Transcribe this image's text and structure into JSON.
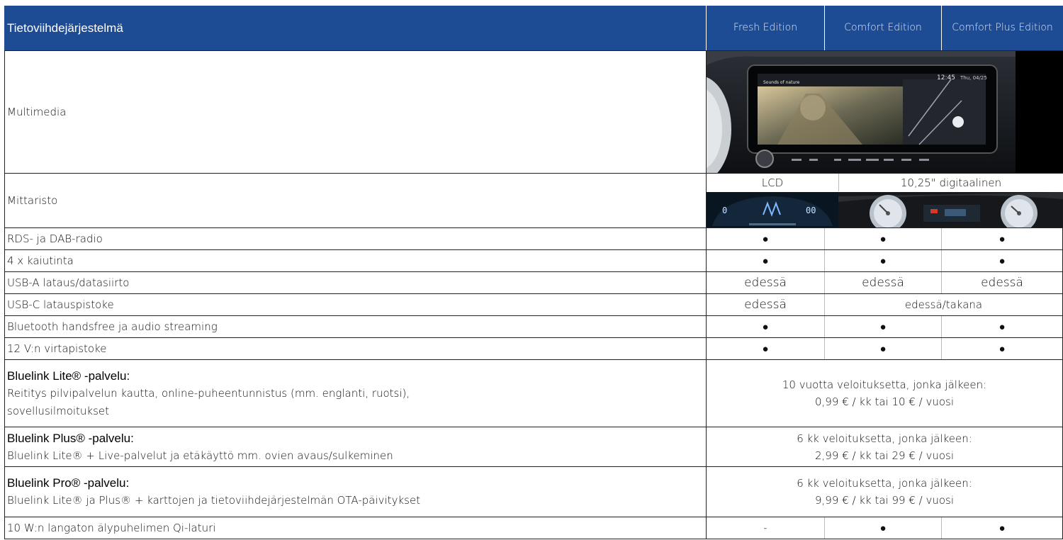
{
  "header": {
    "title": "Tietoviihdejärjestelmä",
    "columns": [
      "Fresh Edition",
      "Comfort Edition",
      "Comfort Plus Edition"
    ]
  },
  "rows": {
    "multimedia": {
      "label": "Multimedia"
    },
    "mittaristo": {
      "label": "Mittaristo",
      "fresh": "LCD",
      "comfort": "10,25\" digitaalinen"
    },
    "radio": {
      "label": "RDS- ja DAB-radio",
      "fresh": "●",
      "comfort": "●",
      "comfort_plus": "●"
    },
    "speakers": {
      "label": "4 x kaiutinta",
      "fresh": "●",
      "comfort": "●",
      "comfort_plus": "●"
    },
    "usb_a": {
      "label": "USB-A lataus/datasiirto",
      "fresh": "edessä",
      "comfort": "edessä",
      "comfort_plus": "edessä"
    },
    "usb_c": {
      "label": "USB-C latauspistoke",
      "fresh": "edessä",
      "comfort_span": "edessä/takana"
    },
    "bluetooth": {
      "label": "Bluetooth handsfree ja audio streaming",
      "fresh": "●",
      "comfort": "●",
      "comfort_plus": "●"
    },
    "v12": {
      "label": "12 V:n virtapistoke",
      "fresh": "●",
      "comfort": "●",
      "comfort_plus": "●"
    },
    "bluelink_lite": {
      "title": "Bluelink Lite® -palvelu:",
      "desc_1": "Reititys pilvipalvelun kautta, online-puheentunnistus (mm. englanti, ruotsi),",
      "desc_2": "sovellusilmoitukset",
      "value_1": "10 vuotta veloituksetta, jonka jälkeen:",
      "value_2": "0,99 € / kk tai 10 € / vuosi"
    },
    "bluelink_plus": {
      "title": "Bluelink Plus® -palvelu:",
      "desc_1": "Bluelink Lite® + Live-palvelut ja etäkäyttö mm. ovien avaus/sulkeminen",
      "value_1": "6 kk veloituksetta, jonka jälkeen:",
      "value_2": "2,99 € / kk tai 29 € / vuosi"
    },
    "bluelink_pro": {
      "title": "Bluelink Pro® -palvelu:",
      "desc_1": "Bluelink Lite® ja Plus® + karttojen ja tietoviihdejärjestelmän OTA-päivitykset",
      "value_1": "6 kk veloituksetta, jonka jälkeen:",
      "value_2": "9,99 € / kk tai 99 € / vuosi"
    },
    "qi": {
      "label": "10 W:n langaton älypuhelimen Qi-laturi",
      "fresh": "-",
      "comfort": "●",
      "comfort_plus": "●"
    }
  },
  "images": {
    "screen_time": "12:45",
    "screen_date": "Thu, 04/25",
    "screen_title": "Sounds of nature",
    "lcd_left": "0",
    "lcd_right": "00"
  },
  "colors": {
    "header_bg": "#1e4c94",
    "header_text": "#ffffff"
  }
}
